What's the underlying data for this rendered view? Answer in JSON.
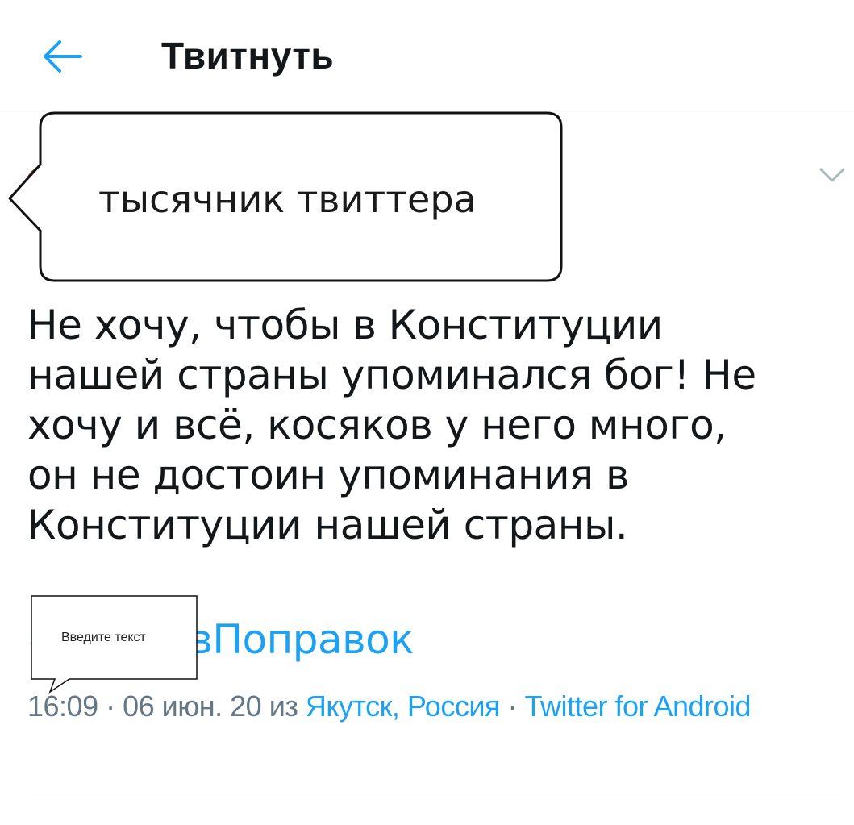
{
  "header": {
    "title": "Твитнуть",
    "back_icon": "arrow-left-icon"
  },
  "colors": {
    "accent": "#1da1f2",
    "text": "#14171a",
    "muted": "#657786",
    "divider": "#e1e8ed"
  },
  "overlay": {
    "name_bubble_text": "тысячник твиттера",
    "input_bubble_text": "Введите текст"
  },
  "tweet": {
    "text_lines": [
      "Не хочу, чтобы в Конституции",
      "нашей страны упоминался бог! Не",
      "хочу и всё, косяков у него много,",
      "он не достоин упоминания в",
      "Конституции нашей страны."
    ],
    "hashtag": "#ПротивПоправок",
    "time": "16:09",
    "date": "06 июн. 20",
    "from_word": "из",
    "location": "Якутск, Россия",
    "source": "Twitter for Android",
    "separator": "·"
  }
}
